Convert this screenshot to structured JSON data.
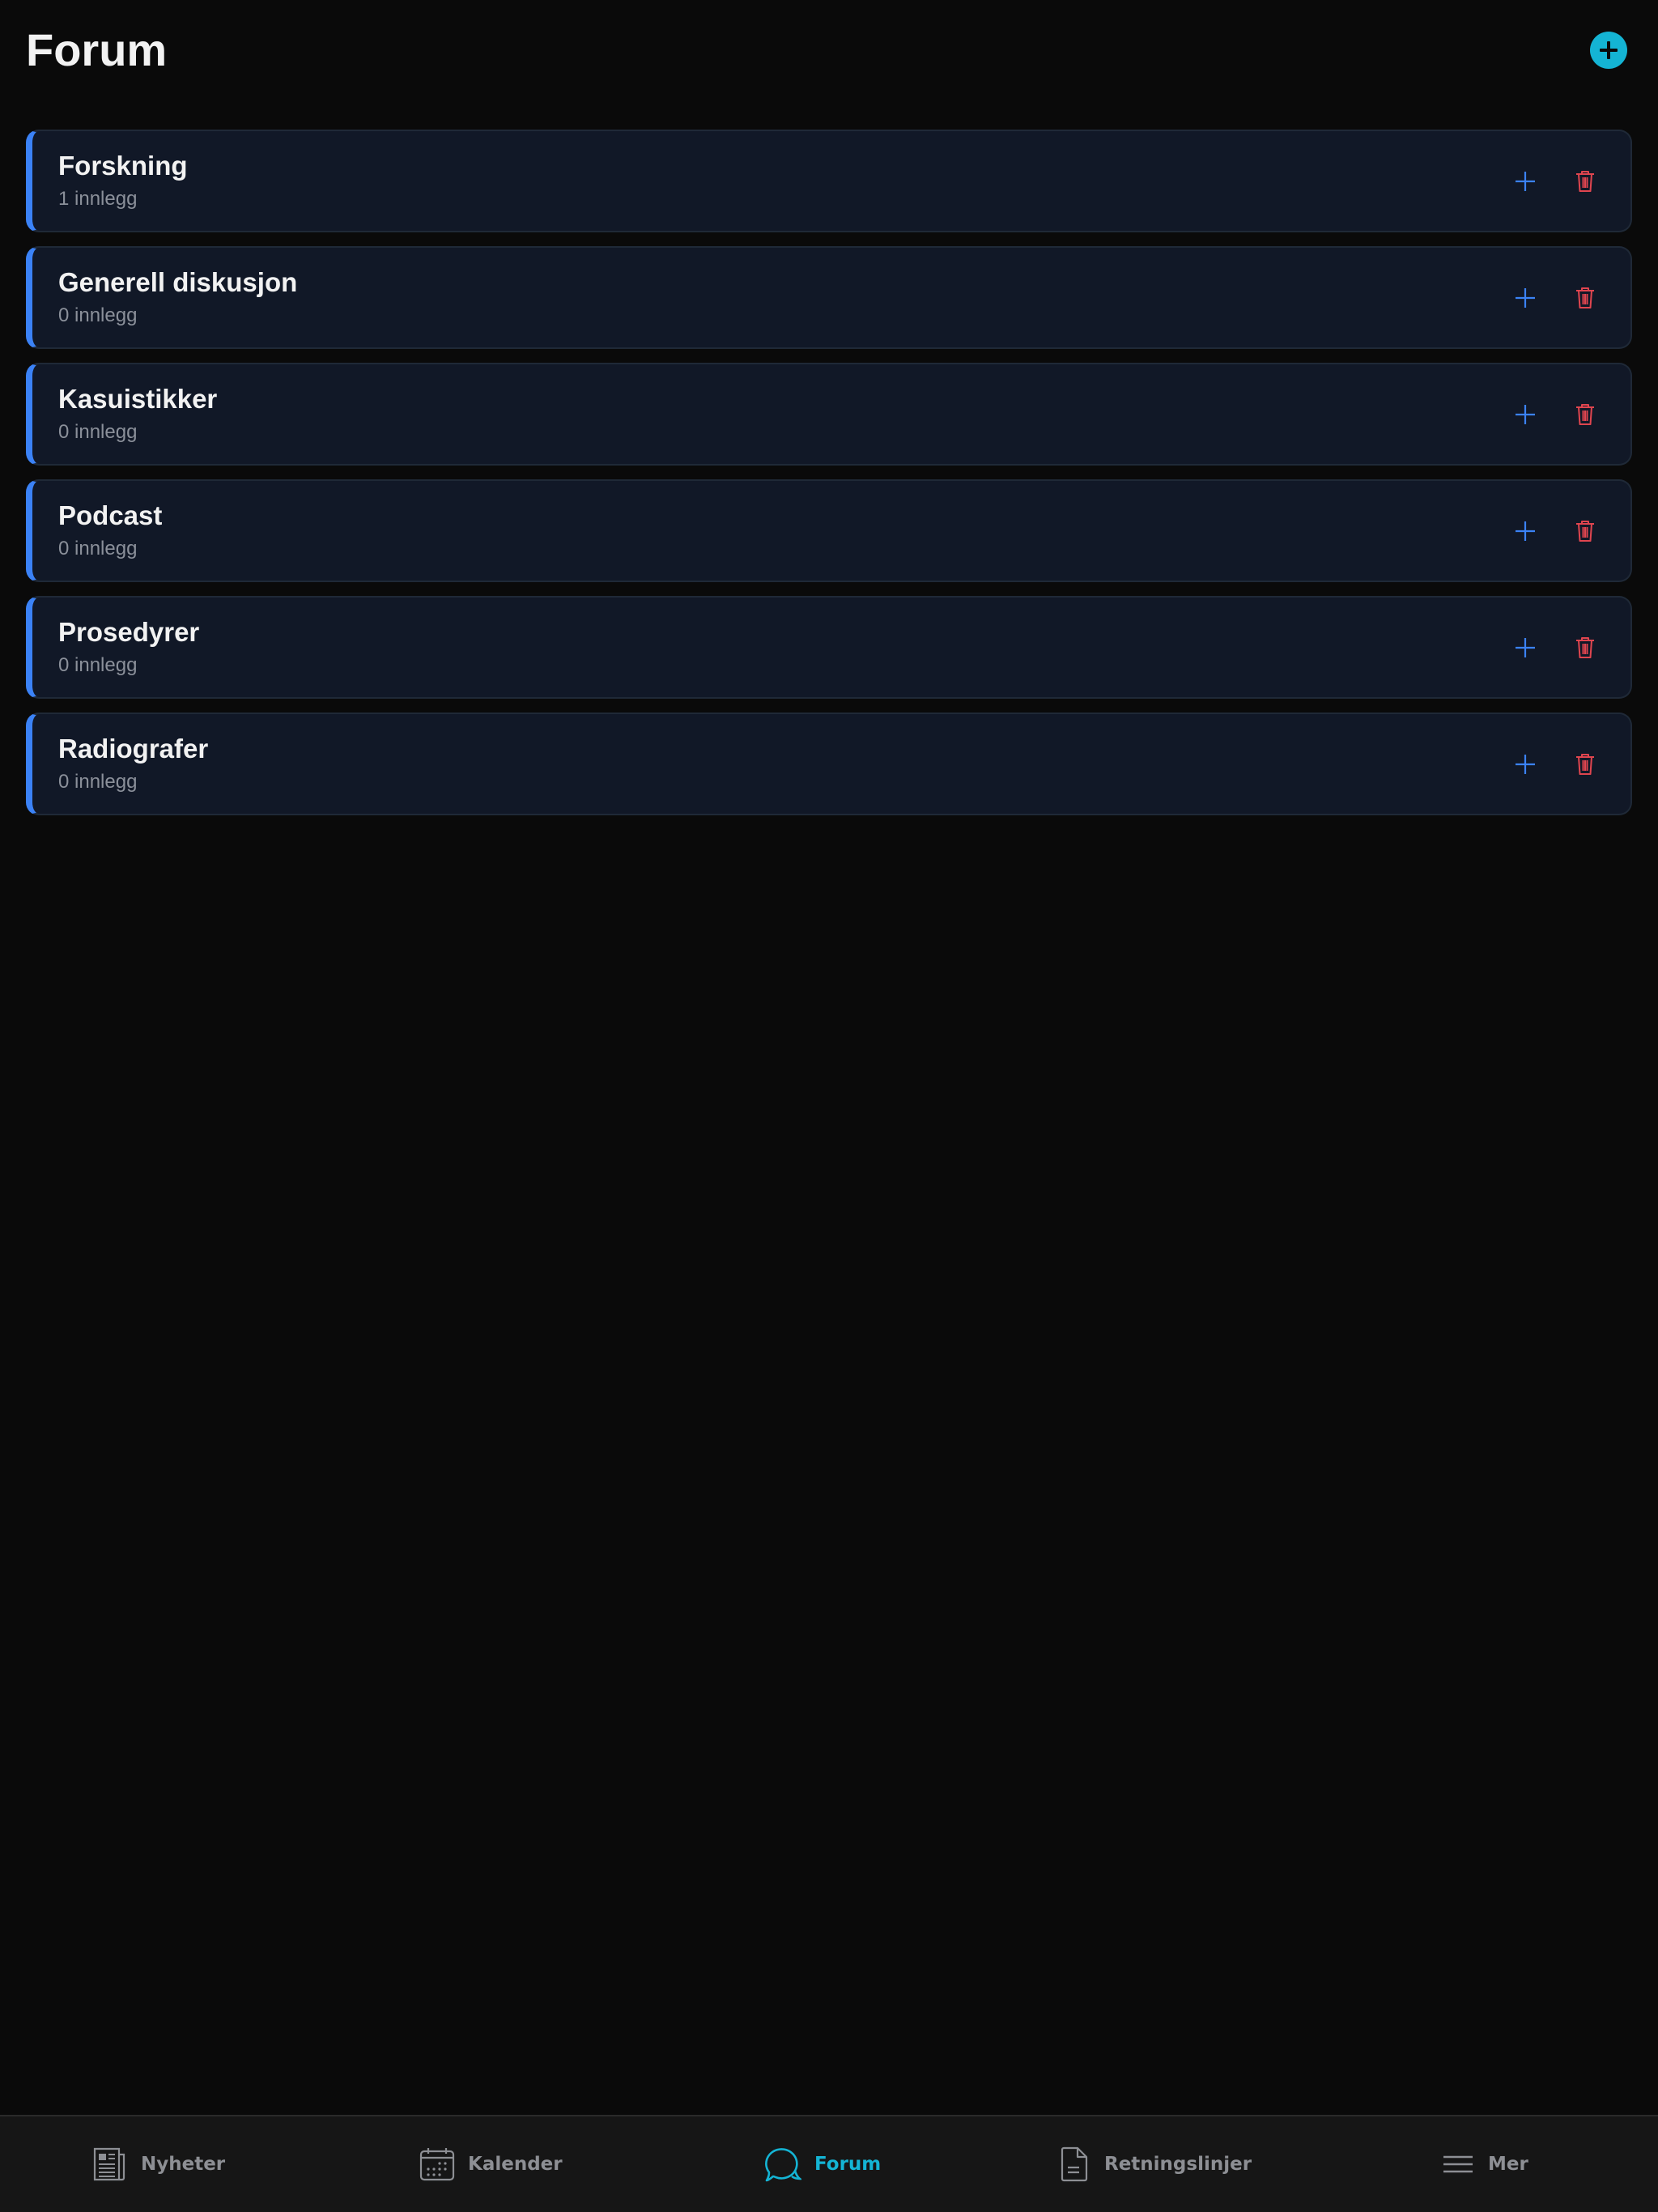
{
  "header": {
    "title": "Forum",
    "add_icon": "plus-circle-icon"
  },
  "categories": [
    {
      "name": "Forskning",
      "count": "1 innlegg"
    },
    {
      "name": "Generell diskusjon",
      "count": "0 innlegg"
    },
    {
      "name": "Kasuistikker",
      "count": "0 innlegg"
    },
    {
      "name": "Podcast",
      "count": "0 innlegg"
    },
    {
      "name": "Prosedyrer",
      "count": "0 innlegg"
    },
    {
      "name": "Radiografer",
      "count": "0 innlegg"
    }
  ],
  "card_icons": {
    "add": "plus-icon",
    "delete": "trash-icon"
  },
  "nav": {
    "items": [
      {
        "label": "Nyheter",
        "icon": "newspaper-icon",
        "active": false
      },
      {
        "label": "Kalender",
        "icon": "calendar-icon",
        "active": false
      },
      {
        "label": "Forum",
        "icon": "chat-bubble-icon",
        "active": true
      },
      {
        "label": "Retningslinjer",
        "icon": "document-icon",
        "active": false
      },
      {
        "label": "Mer",
        "icon": "menu-icon",
        "active": false
      }
    ]
  },
  "colors": {
    "background": "#0a0a0a",
    "accent": "#14b4d4",
    "card_border_accent": "#3b82f6",
    "delete": "#e0454f",
    "nav_inactive": "#8d8f94"
  }
}
